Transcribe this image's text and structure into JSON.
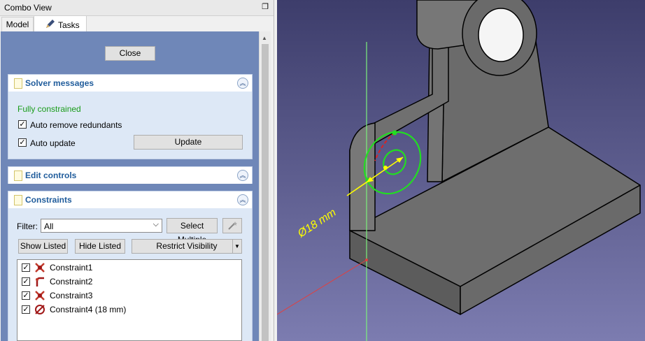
{
  "window": {
    "title": "Combo View"
  },
  "tabs": [
    {
      "label": "Model"
    },
    {
      "label": "Tasks"
    }
  ],
  "close_button": "Close",
  "solver": {
    "title": "Solver messages",
    "status": "Fully constrained",
    "status_color": "#1a9c1a",
    "auto_remove": {
      "label": "Auto remove redundants",
      "checked": true
    },
    "auto_update": {
      "label": "Auto update",
      "checked": true
    },
    "update_button": "Update"
  },
  "edit_controls": {
    "title": "Edit controls"
  },
  "constraints": {
    "title": "Constraints",
    "filter_label": "Filter:",
    "filter_value": "All",
    "select_multiple": "Select Multiple",
    "show_listed": "Show Listed",
    "hide_listed": "Hide Listed",
    "restrict_visibility": "Restrict Visibility",
    "items": [
      {
        "name": "Constraint1",
        "icon": "coincident-icon",
        "checked": true
      },
      {
        "name": "Constraint2",
        "icon": "tangent-icon",
        "checked": true
      },
      {
        "name": "Constraint3",
        "icon": "coincident-icon",
        "checked": true
      },
      {
        "name": "Constraint4 (18 mm)",
        "icon": "diameter-icon",
        "checked": true
      }
    ]
  },
  "viewport": {
    "dimension_label": "Ø18 mm",
    "background_top": "#3d3d6b",
    "background_bottom": "#7c7cb0",
    "part_color": "#6b6b6b",
    "sketch_color": "#22dd22",
    "dimension_color": "#ffff00"
  }
}
